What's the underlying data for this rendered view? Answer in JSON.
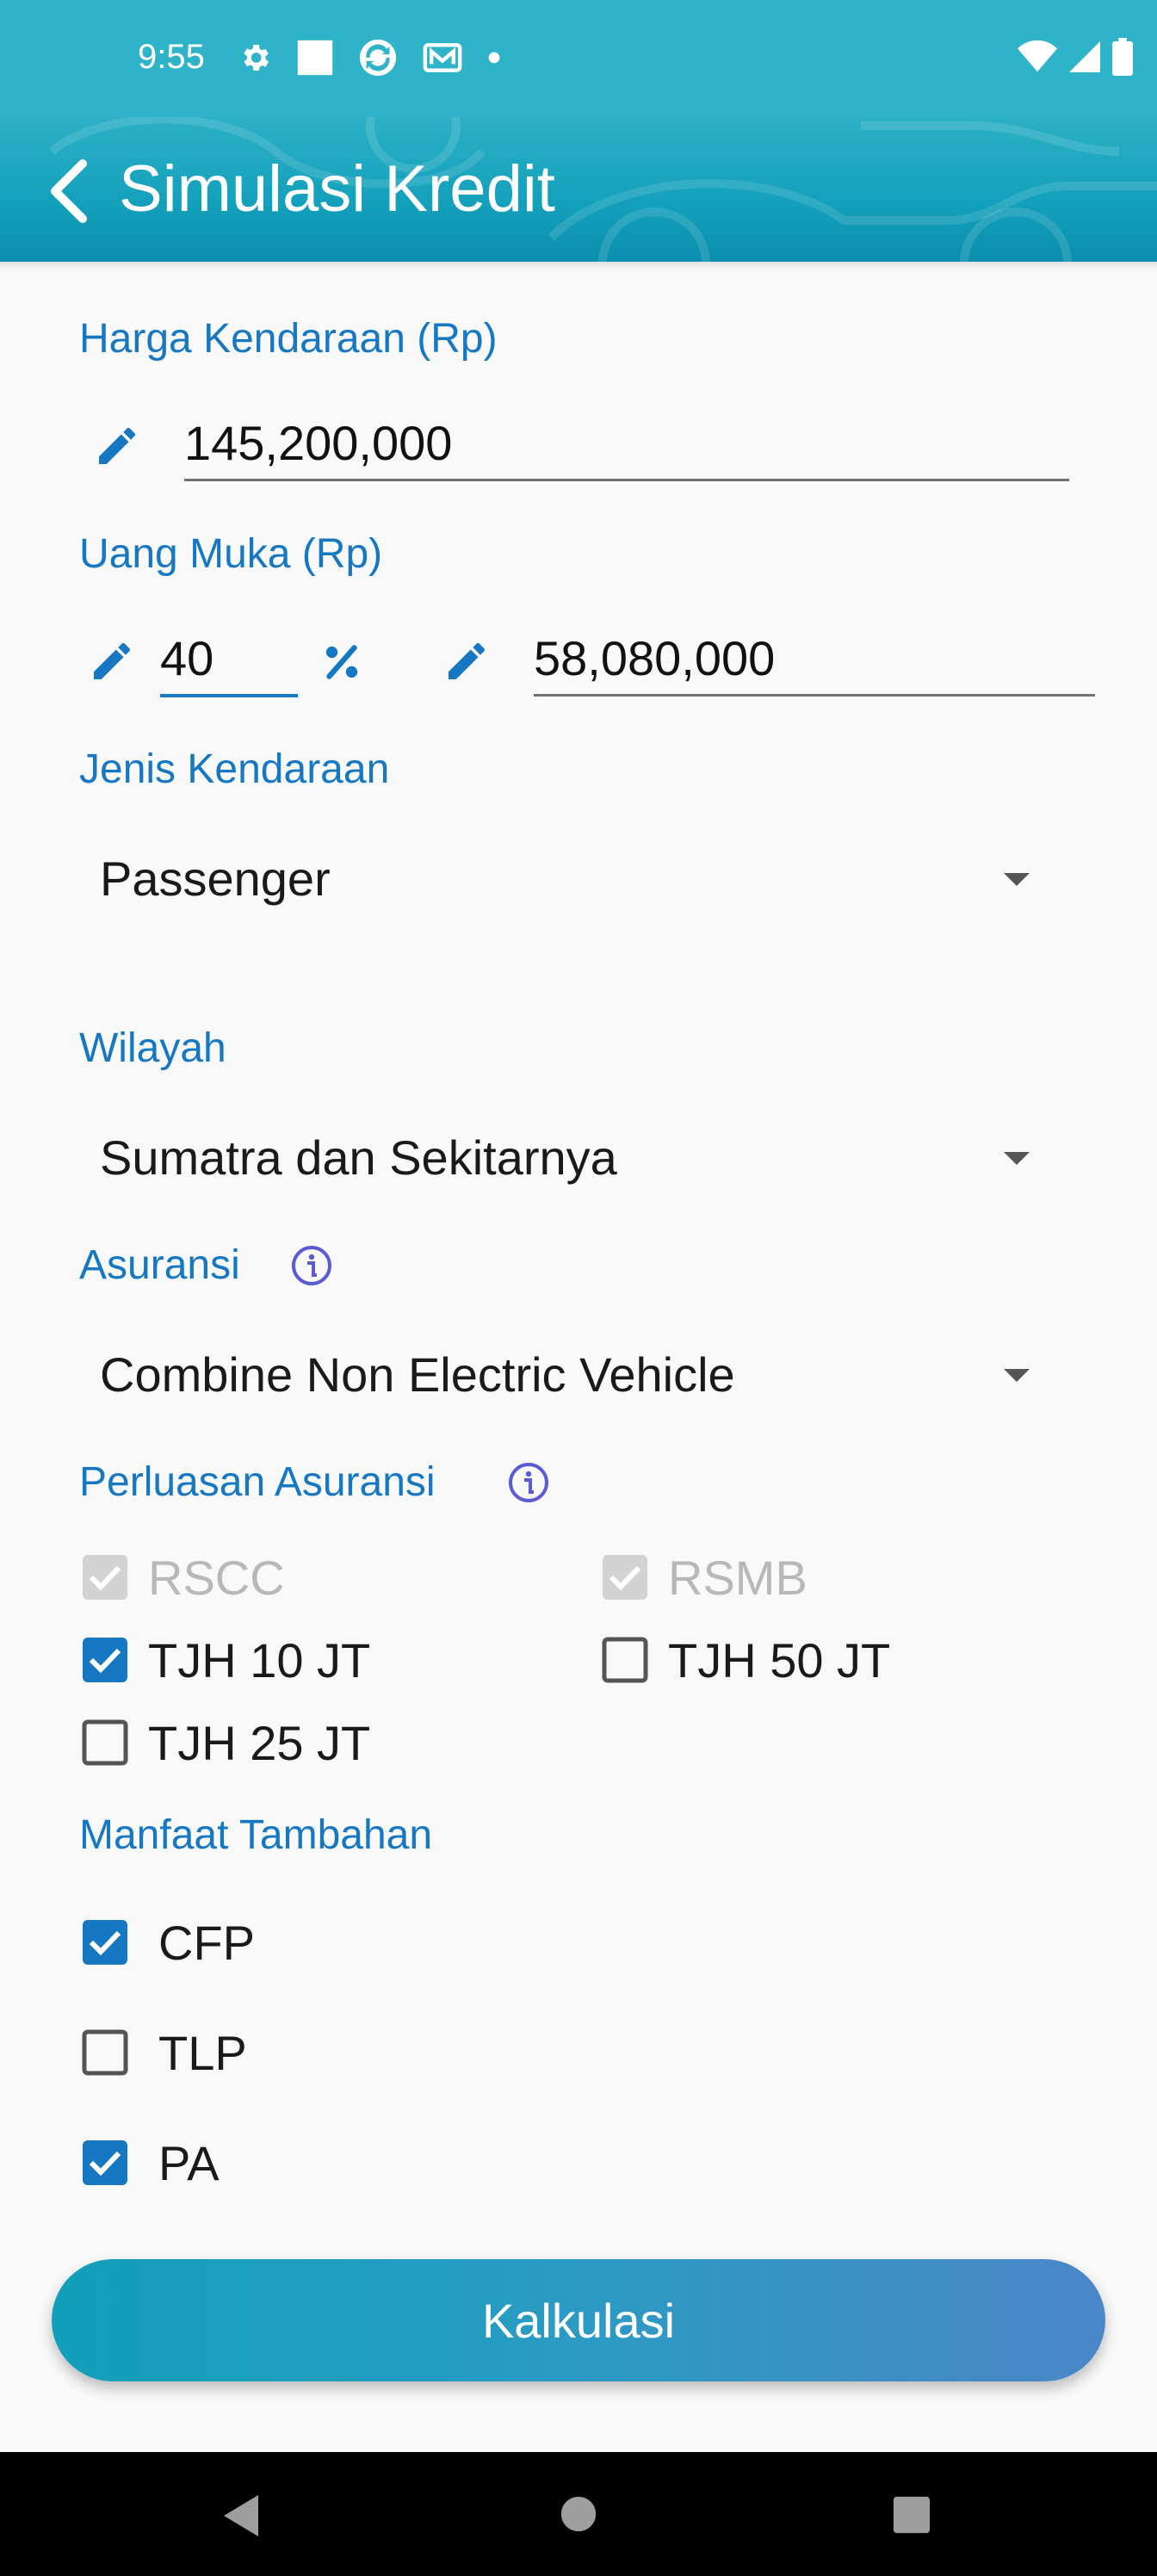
{
  "status_bar": {
    "time": "9:55"
  },
  "app_bar": {
    "title": "Simulasi Kredit"
  },
  "vehicle_price": {
    "label": "Harga Kendaraan (Rp)",
    "value": "145,200,000"
  },
  "down_payment": {
    "label": "Uang Muka (Rp)",
    "percent": "40",
    "amount": "58,080,000"
  },
  "vehicle_type": {
    "label": "Jenis Kendaraan",
    "selected": "Passenger"
  },
  "region": {
    "label": "Wilayah",
    "selected": "Sumatra dan Sekitarnya"
  },
  "insurance": {
    "label": "Asuransi",
    "selected": "Combine Non Electric Vehicle"
  },
  "insurance_extension": {
    "label": "Perluasan Asuransi",
    "options": [
      {
        "label": "RSCC",
        "checked": true,
        "disabled": true
      },
      {
        "label": "RSMB",
        "checked": true,
        "disabled": true
      },
      {
        "label": "TJH 10 JT",
        "checked": true,
        "disabled": false
      },
      {
        "label": "TJH 50 JT",
        "checked": false,
        "disabled": false
      },
      {
        "label": "TJH 25 JT",
        "checked": false,
        "disabled": false
      }
    ]
  },
  "extra_benefits": {
    "label": "Manfaat Tambahan",
    "options": [
      {
        "label": "CFP",
        "checked": true
      },
      {
        "label": "TLP",
        "checked": false
      },
      {
        "label": "PA",
        "checked": true
      }
    ]
  },
  "calculate_button": {
    "label": "Kalkulasi"
  },
  "colors": {
    "primary": "#1677c2",
    "header": "#2fb3c8",
    "info": "#5b5bd6"
  }
}
